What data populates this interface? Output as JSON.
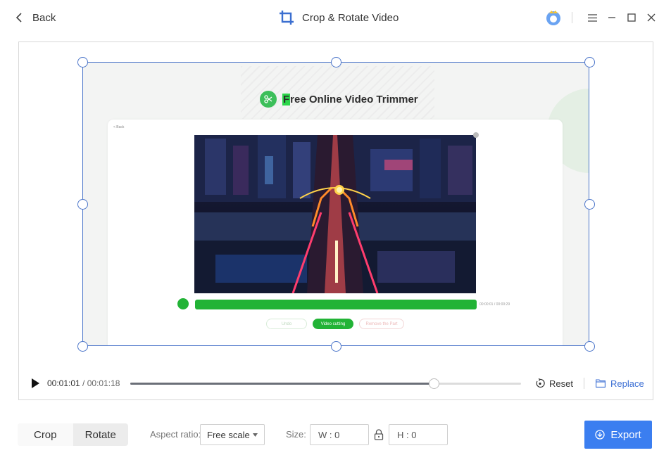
{
  "header": {
    "back_label": "Back",
    "title": "Crop & Rotate Video",
    "icons": [
      "chevron-left-icon",
      "crop-icon",
      "user-avatar-icon",
      "menu-icon",
      "minimize-icon",
      "maximize-icon",
      "close-icon"
    ]
  },
  "preview": {
    "brand_prefix": "F",
    "brand_rest": "ree Online Video Trimmer",
    "card_back": "< Back",
    "mini_time": "00:00:01 / 00:00:29",
    "undo_label": "Undo",
    "cut_label": "Video cutting",
    "remove_label": "Remove the Part"
  },
  "playback": {
    "current": "00:01:01",
    "separator": " / ",
    "total": "00:01:18",
    "progress": 0.777,
    "reset_label": "Reset",
    "replace_label": "Replace"
  },
  "toolbar": {
    "tabs": [
      "Crop",
      "Rotate"
    ],
    "active_tab": "Crop",
    "aspect_label": "Aspect ratio:",
    "aspect_value": "Free scale",
    "size_label": "Size:",
    "width_value": "W : 0",
    "height_value": "H : 0",
    "export_label": "Export"
  },
  "colors": {
    "accent": "#3b7ef0",
    "crop_border": "#4a74c9",
    "trimmer_green": "#22b336"
  }
}
